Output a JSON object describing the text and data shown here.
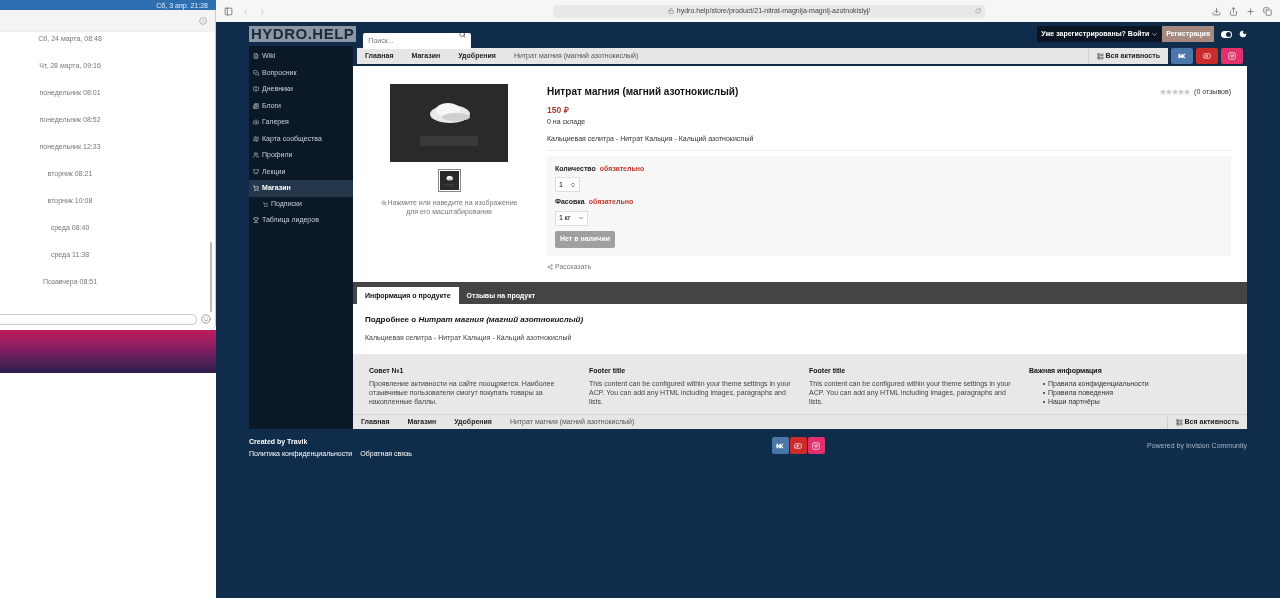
{
  "desktop": {
    "clock": "Сб, 3 апр. 21:28",
    "chat": {
      "timestamps": [
        "Сб, 24 марта, 08:48",
        "Чт, 28 марта, 09:16",
        "понедельник 08:01",
        "понедельник 08:52",
        "понедельник 12:33",
        "вторник 08:21",
        "вторник 10:08",
        "среда 08:40",
        "среда 11:38",
        "Позавчера 08:51"
      ]
    }
  },
  "browser": {
    "url": "hydro.help/store/product/21-nitrat-magnija-magnij-azotnokislyj/"
  },
  "site": {
    "logo": "HYDRO.HELP",
    "search": {
      "placeholder": "Поиск..."
    },
    "login": "Уже зарегистрированы? Войти",
    "register": "Регистрация",
    "theme_toggle": {
      "on": true
    },
    "sidebar": [
      {
        "label": "Wiki",
        "selected": false
      },
      {
        "label": "Вопросник",
        "selected": false
      },
      {
        "label": "Дневники",
        "selected": false
      },
      {
        "label": "Блоги",
        "selected": false
      },
      {
        "label": "Галерея",
        "selected": false
      },
      {
        "label": "Карта сообщества",
        "selected": false
      },
      {
        "label": "Профили",
        "selected": false
      },
      {
        "label": "Лекции",
        "selected": false
      },
      {
        "label": "Магазин",
        "selected": true,
        "children": [
          {
            "label": "Подписки",
            "selected": false
          }
        ]
      },
      {
        "label": "Таблица лидеров",
        "selected": false
      }
    ],
    "breadcrumb": [
      "Главная",
      "Магазин",
      "Удобрения",
      "Нитрат магния (магний азотнокислый)"
    ],
    "activity": "Вся активность",
    "socials": [
      {
        "kind": "vk",
        "color": "#4a76a8"
      },
      {
        "kind": "youtube",
        "color": "#cc2b2b"
      },
      {
        "kind": "instagram",
        "color": "#e1306c"
      }
    ],
    "product": {
      "title": "Нитрат магния (магний азотнокислый)",
      "stars": 0,
      "reviews": "(0 отзывов)",
      "price": "150 ₽",
      "stock": "0 на складе",
      "description": "Кальциевая селитра - Нитрат Кальция - Кальций азотнокислый",
      "zoom_hint": "Нажмите или наведите на изображение для его масштабирования",
      "options": [
        {
          "kind": "number",
          "label": "Количество",
          "required": "обязательно",
          "value": "1"
        },
        {
          "kind": "select",
          "label": "Фасовка",
          "required": "обязательно",
          "value": "1 кг"
        }
      ],
      "buy_button": {
        "label": "Нет в наличии",
        "disabled": true
      },
      "share": "Рассказать"
    },
    "tabs": [
      {
        "label": "Информация о продукте",
        "selected": true
      },
      {
        "label": "Отзывы на продукт",
        "selected": false
      }
    ],
    "details": {
      "heading": "Подробнее о *Нитрат магния (магний азотнокислый)*",
      "text": "Кальциевая селитра - Нитрат Кальция - Кальций азотнокислый"
    },
    "footer_columns": [
      {
        "title": "Совет №1",
        "text": "Проявление активности на сайте поощряется. Наиболее отзывчивые пользователи смогут покупать товары за накопленные баллы."
      },
      {
        "title": "Footer title",
        "text": "This content can be configured within your theme settings in your ACP. You can add any HTML including images, paragraphs and lists."
      },
      {
        "title": "Footer title",
        "text": "This content can be configured within your theme settings in your ACP. You can add any HTML including images, paragraphs and lists."
      },
      {
        "title": "Важная информация",
        "links": [
          "Правила конфиденциальности",
          "Правила поведения",
          "Наши партнёры"
        ]
      }
    ],
    "bottom_breadcrumb": [
      "Главная",
      "Магазин",
      "Удобрения",
      "Нитрат магния (магний азотнокислый)"
    ],
    "bottom_activity": "Вся активность",
    "page_footer": {
      "credit": "Created by Travik",
      "links": [
        "Политика конфиденциальности",
        "Обратная связь"
      ],
      "socials": [
        {
          "kind": "vk",
          "color": "#4a76a8"
        },
        {
          "kind": "youtube",
          "color": "#cc2b2b"
        },
        {
          "kind": "instagram",
          "color": "#e1306c"
        }
      ],
      "powered": "Powered by Invision Community"
    }
  }
}
